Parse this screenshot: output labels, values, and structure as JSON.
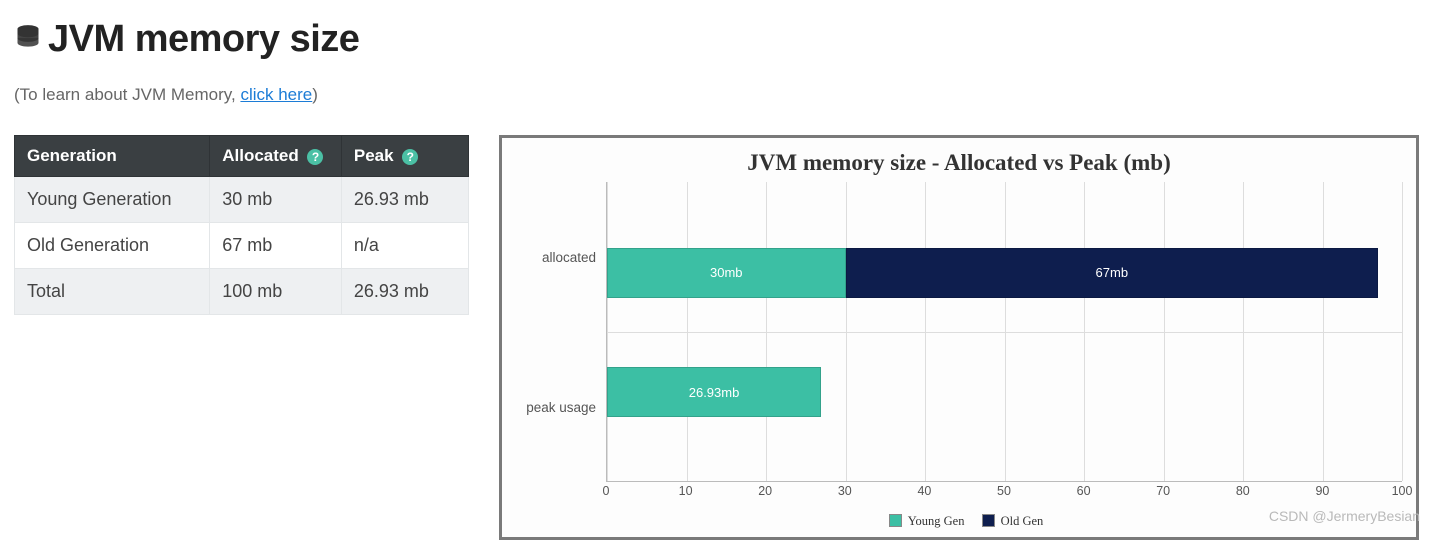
{
  "header": {
    "title": "JVM memory size",
    "help_prefix": "(To learn about JVM Memory, ",
    "help_link": "click here",
    "help_suffix": ")"
  },
  "table": {
    "columns": {
      "c0": "Generation",
      "c1": "Allocated",
      "c2": "Peak"
    },
    "rows": [
      {
        "gen": "Young Generation",
        "alloc": "30 mb",
        "peak": "26.93 mb"
      },
      {
        "gen": "Old Generation",
        "alloc": "67 mb",
        "peak": "n/a"
      },
      {
        "gen": "Total",
        "alloc": "100 mb",
        "peak": "26.93 mb"
      }
    ]
  },
  "chart": {
    "title": "JVM memory size - Allocated vs Peak (mb)",
    "ylabels": {
      "allocated": "allocated",
      "peak": "peak usage"
    },
    "legend": {
      "young": "Young Gen",
      "old": "Old Gen"
    },
    "colors": {
      "young": "#3CBFA4",
      "old": "#0E1E4E"
    },
    "ticks": [
      0,
      10,
      20,
      30,
      40,
      50,
      60,
      70,
      80,
      90,
      100
    ],
    "bar_labels": {
      "alloc_young": "30mb",
      "alloc_old": "67mb",
      "peak_young": "26.93mb"
    }
  },
  "watermark": "CSDN @JermeryBesian",
  "chart_data": {
    "type": "bar",
    "orientation": "horizontal",
    "stacked": true,
    "title": "JVM memory size - Allocated vs Peak (mb)",
    "xlabel": "",
    "ylabel": "",
    "xlim": [
      0,
      100
    ],
    "categories": [
      "allocated",
      "peak usage"
    ],
    "series": [
      {
        "name": "Young Gen",
        "values": [
          30,
          26.93
        ],
        "color": "#3CBFA4"
      },
      {
        "name": "Old Gen",
        "values": [
          67,
          0
        ],
        "color": "#0E1E4E"
      }
    ],
    "ticks_x": [
      0,
      10,
      20,
      30,
      40,
      50,
      60,
      70,
      80,
      90,
      100
    ]
  }
}
